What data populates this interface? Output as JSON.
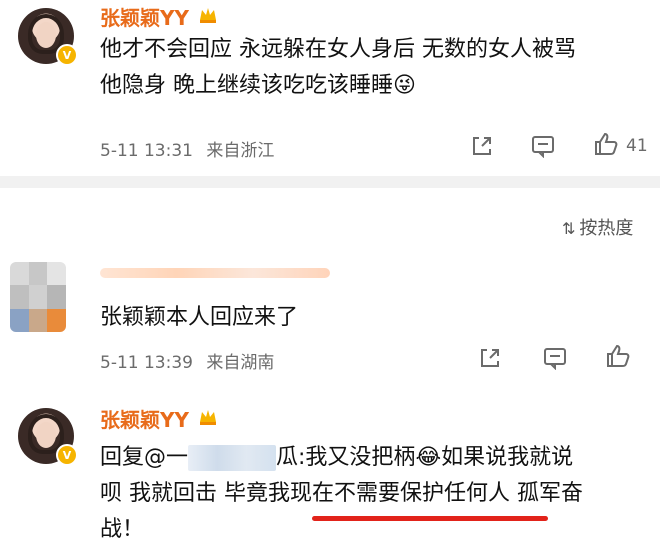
{
  "comment1": {
    "username": "张颖颖YY",
    "content_line1": "他才不会回应 永远躲在女人身后 无数的女人被骂",
    "content_line2": "他隐身 晚上继续该吃吃该睡睡",
    "emoji": "😜",
    "timestamp": "5-11 13:31",
    "location": "来自浙江",
    "likes": "41"
  },
  "sort": {
    "label": "按热度"
  },
  "comment2": {
    "content": "张颖颖本人回应来了",
    "timestamp": "5-11 13:39",
    "location": "来自湖南"
  },
  "comment3": {
    "username": "张颖颖YY",
    "line1_prefix": "回复@一",
    "line1_suffix": "瓜:我又没把柄",
    "emoji": "😂",
    "line1_end": "如果说我就说",
    "line2": "呗 我就回击 毕竟我现在不需要保护任何人 孤军奋",
    "line3": "战！"
  },
  "colors": {
    "username": "#e86b1a",
    "underline": "#e2231a",
    "meta": "#6b6b6b",
    "divider": "#f1f1f1"
  }
}
